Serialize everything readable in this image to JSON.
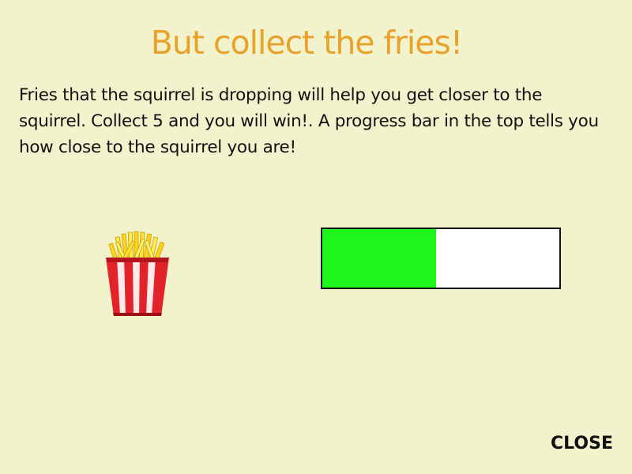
{
  "dialog": {
    "title": "But collect the fries!",
    "description": "Fries that the squirrel is dropping will help you get closer to the squirrel. Collect 5 and you will win!. A progress bar in the top tells you how close to the squirrel you are!",
    "close_label": "CLOSE"
  },
  "illustration": {
    "icon": "fries-icon"
  },
  "progress": {
    "value": 0.48,
    "fill_color": "#1ef51a",
    "track_color": "#ffffff"
  },
  "colors": {
    "background": "#f2f2cc",
    "title": "#e8a22c",
    "text": "#111111"
  }
}
